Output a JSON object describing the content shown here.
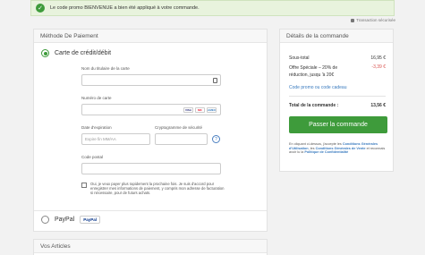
{
  "banner": {
    "message": "Le code promo BIENVENUE a bien été appliqué à votre commande."
  },
  "secure_label": "Transaction sécurisée",
  "payment": {
    "title": "Méthode De Paiement",
    "card_option": "Carte de crédit/débit",
    "holder_label": "Nom du titulaire de la carte",
    "number_label": "Numéro de carte",
    "card_brands": [
      "VISA",
      "MC",
      "AMEX"
    ],
    "expiry_label": "Date d'expiration",
    "expiry_placeholder": "Expire fin MM/AA",
    "cvv_label": "Cryptogramme de sécurité",
    "help_glyph": "?",
    "postal_label": "Code postal",
    "consent_text": "Oui, je veux payer plus rapidement la prochaine fois. Je suis d'accord pour enregistrer mes informations de paiement, y compris mon adresse de facturation si nécessaire, pour de futurs achats.",
    "paypal_option": "PayPal",
    "paypal_logo": "PayPal"
  },
  "articles": {
    "title": "Vos Articles"
  },
  "summary": {
    "title": "Détails de la commande",
    "subtotal_label": "Sous-total",
    "subtotal_value": "16,95 €",
    "discount_label_line1": "Offre Spéciale – 20% de",
    "discount_label_line2": "réduction, jusqu 'à 20€",
    "discount_value": "-3,39 €",
    "promo_link": "Code promo ou code cadeau",
    "total_label": "Total de la commande :",
    "total_value": "13,56 €",
    "button": "Passer la commande",
    "legal_pre": "En cliquant ci-dessus, j'accepte les ",
    "legal_link1": "Conditions Générales d'Utilisation",
    "legal_mid1": ", les ",
    "legal_link2": "Conditions Générales de Vente",
    "legal_mid2": " et reconnais avoir lu la ",
    "legal_link3": "Politique de Confidentialité"
  }
}
